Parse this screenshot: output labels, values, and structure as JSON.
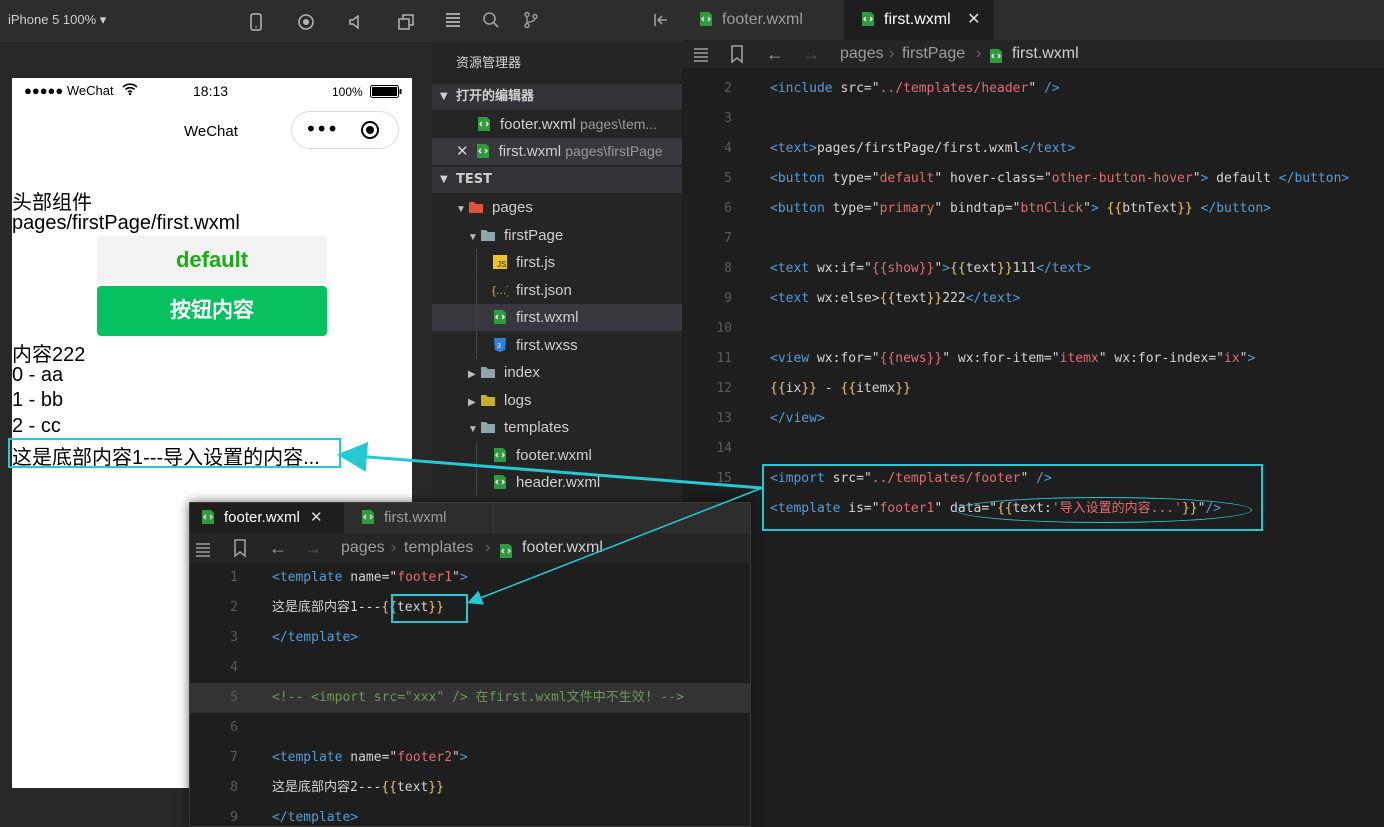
{
  "simulator": {
    "device_label": "iPhone 5 100% ▾",
    "status": {
      "carrier": "●●●●● WeChat",
      "time": "18:13",
      "battery": "100%"
    },
    "nav_title": "WeChat",
    "content": {
      "header_text": "头部组件",
      "path_text": "pages/firstPage/first.wxml",
      "default_button": "default",
      "primary_button": "按钮内容",
      "else_text": "内容222",
      "list": [
        "0 - aa",
        "1 - bb",
        "2 - cc"
      ],
      "footer_text": "这是底部内容1---导入设置的内容..."
    }
  },
  "explorer": {
    "title": "资源管理器",
    "open_editors_label": "打开的编辑器",
    "open_editors": [
      {
        "name": "footer.wxml",
        "path": "pages\\tem..."
      },
      {
        "name": "first.wxml",
        "path": "pages\\firstPage"
      }
    ],
    "project_label": "TEST",
    "tree": [
      {
        "name": "pages",
        "icon": "folder-red-icon",
        "arrow": "▼"
      },
      {
        "name": "firstPage",
        "icon": "folder-open-icon",
        "arrow": "▼"
      },
      {
        "name": "first.js",
        "icon": "js-file-icon",
        "arrow": ""
      },
      {
        "name": "first.json",
        "icon": "json-file-icon",
        "arrow": ""
      },
      {
        "name": "first.wxml",
        "icon": "wxml-file-icon",
        "arrow": ""
      },
      {
        "name": "first.wxss",
        "icon": "css-file-icon",
        "arrow": ""
      },
      {
        "name": "index",
        "icon": "folder-icon",
        "arrow": "▶"
      },
      {
        "name": "logs",
        "icon": "folder-yellow-icon",
        "arrow": "▶"
      },
      {
        "name": "templates",
        "icon": "folder-icon",
        "arrow": "▼"
      },
      {
        "name": "footer.wxml",
        "icon": "wxml-file-icon",
        "arrow": ""
      },
      {
        "name": "header.wxml",
        "icon": "wxml-file-icon",
        "arrow": ""
      }
    ]
  },
  "editor": {
    "tabs": [
      {
        "label": "footer.wxml",
        "active": false
      },
      {
        "label": "first.wxml",
        "active": true,
        "close": "✕"
      }
    ],
    "breadcrumb": [
      "pages",
      "firstPage",
      "first.wxml"
    ],
    "lines": [
      {
        "n": "2",
        "parts": [
          [
            "c-tag",
            "<include "
          ],
          [
            "c-attr",
            "src="
          ],
          [
            "c-q",
            "\""
          ],
          [
            "c-str",
            "../templates/header"
          ],
          [
            "c-q",
            "\""
          ],
          [
            "c-tag",
            " />"
          ]
        ]
      },
      {
        "n": "3",
        "parts": []
      },
      {
        "n": "4",
        "parts": [
          [
            "c-tag",
            "<text>"
          ],
          [
            "c-attr",
            "pages/firstPage/first.wxml"
          ],
          [
            "c-tag",
            "</text>"
          ]
        ]
      },
      {
        "n": "5",
        "parts": [
          [
            "c-tag",
            "<button "
          ],
          [
            "c-attr",
            "type="
          ],
          [
            "c-q",
            "\""
          ],
          [
            "c-str",
            "default"
          ],
          [
            "c-q",
            "\""
          ],
          [
            "c-attr",
            " hover-class="
          ],
          [
            "c-q",
            "\""
          ],
          [
            "c-str",
            "other-button-hover"
          ],
          [
            "c-q",
            "\""
          ],
          [
            "c-tag",
            "> "
          ],
          [
            "c-attr",
            "default "
          ],
          [
            "c-tag",
            "</button>"
          ]
        ]
      },
      {
        "n": "6",
        "parts": [
          [
            "c-tag",
            "<button "
          ],
          [
            "c-attr",
            "type="
          ],
          [
            "c-q",
            "\""
          ],
          [
            "c-str",
            "primary"
          ],
          [
            "c-q",
            "\""
          ],
          [
            "c-attr",
            " bindtap="
          ],
          [
            "c-q",
            "\""
          ],
          [
            "c-str",
            "btnClick"
          ],
          [
            "c-q",
            "\""
          ],
          [
            "c-tag",
            "> "
          ],
          [
            "c-br",
            "{{"
          ],
          [
            "c-attr",
            "btnText"
          ],
          [
            "c-br",
            "}}"
          ],
          [
            "c-tag",
            " </button>"
          ]
        ]
      },
      {
        "n": "7",
        "parts": []
      },
      {
        "n": "8",
        "parts": [
          [
            "c-tag",
            "<text "
          ],
          [
            "c-attr",
            "wx:if="
          ],
          [
            "c-q",
            "\""
          ],
          [
            "c-str",
            "{{show}}"
          ],
          [
            "c-q",
            "\""
          ],
          [
            "c-tag",
            ">"
          ],
          [
            "c-br",
            "{{"
          ],
          [
            "c-attr",
            "text"
          ],
          [
            "c-br",
            "}}"
          ],
          [
            "c-attr",
            "111"
          ],
          [
            "c-tag",
            "</text>"
          ]
        ]
      },
      {
        "n": "9",
        "parts": [
          [
            "c-tag",
            "<text "
          ],
          [
            "c-attr",
            "wx:else>"
          ],
          [
            "c-br",
            "{{"
          ],
          [
            "c-attr",
            "text"
          ],
          [
            "c-br",
            "}}"
          ],
          [
            "c-attr",
            "222"
          ],
          [
            "c-tag",
            "</text>"
          ]
        ]
      },
      {
        "n": "10",
        "parts": []
      },
      {
        "n": "11",
        "parts": [
          [
            "c-tag",
            "<view "
          ],
          [
            "c-attr",
            "wx:for="
          ],
          [
            "c-q",
            "\""
          ],
          [
            "c-str",
            "{{news}}"
          ],
          [
            "c-q",
            "\""
          ],
          [
            "c-attr",
            " wx:for-item="
          ],
          [
            "c-q",
            "\""
          ],
          [
            "c-str",
            "itemx"
          ],
          [
            "c-q",
            "\""
          ],
          [
            "c-attr",
            " wx:for-index="
          ],
          [
            "c-q",
            "\""
          ],
          [
            "c-str",
            "ix"
          ],
          [
            "c-q",
            "\""
          ],
          [
            "c-tag",
            ">"
          ]
        ]
      },
      {
        "n": "12",
        "parts": [
          [
            "c-attr",
            "  "
          ],
          [
            "c-br",
            "{{"
          ],
          [
            "c-attr",
            "ix"
          ],
          [
            "c-br",
            "}}"
          ],
          [
            "c-attr",
            " - "
          ],
          [
            "c-br",
            "{{"
          ],
          [
            "c-attr",
            "itemx"
          ],
          [
            "c-br",
            "}}"
          ]
        ]
      },
      {
        "n": "13",
        "parts": [
          [
            "c-tag",
            "</view>"
          ]
        ]
      },
      {
        "n": "14",
        "parts": []
      },
      {
        "n": "15",
        "parts": [
          [
            "c-tag",
            "<import "
          ],
          [
            "c-attr",
            "src="
          ],
          [
            "c-q",
            "\""
          ],
          [
            "c-str",
            "../templates/footer"
          ],
          [
            "c-q",
            "\""
          ],
          [
            "c-tag",
            " />"
          ]
        ]
      },
      {
        "n": "",
        "parts": [
          [
            "c-tag",
            "<template "
          ],
          [
            "c-attr",
            "is="
          ],
          [
            "c-q",
            "\""
          ],
          [
            "c-str",
            "footer1"
          ],
          [
            "c-q",
            "\""
          ],
          [
            "c-attr",
            " data="
          ],
          [
            "c-q",
            "\""
          ],
          [
            "c-br",
            "{{"
          ],
          [
            "c-attr",
            "text:"
          ],
          [
            "c-str",
            "'导入设置的内容...'"
          ],
          [
            "c-br",
            "}}"
          ],
          [
            "c-q",
            "\""
          ],
          [
            "c-tag",
            "/>"
          ]
        ]
      }
    ]
  },
  "popup": {
    "tabs": [
      {
        "label": "footer.wxml",
        "active": true,
        "close": "✕"
      },
      {
        "label": "first.wxml",
        "active": false
      }
    ],
    "breadcrumb": [
      "pages",
      "templates",
      "footer.wxml"
    ],
    "lines": [
      {
        "n": "1",
        "parts": [
          [
            "c-tag",
            "<template "
          ],
          [
            "c-attr",
            "name="
          ],
          [
            "c-q",
            "\""
          ],
          [
            "c-str",
            "footer1"
          ],
          [
            "c-q",
            "\""
          ],
          [
            "c-tag",
            ">"
          ]
        ]
      },
      {
        "n": "2",
        "parts": [
          [
            "c-attr",
            "这是底部内容1---"
          ],
          [
            "c-br",
            "{{"
          ],
          [
            "c-attr",
            "text"
          ],
          [
            "c-br",
            "}}"
          ]
        ]
      },
      {
        "n": "3",
        "parts": [
          [
            "c-tag",
            "</template>"
          ]
        ]
      },
      {
        "n": "4",
        "parts": []
      },
      {
        "n": "5",
        "parts": [
          [
            "c-cmt",
            "<!-- <import src=\"xxx\" />   在first.wxml文件中不生效!  -->"
          ]
        ],
        "highlight": true
      },
      {
        "n": "6",
        "parts": []
      },
      {
        "n": "7",
        "parts": [
          [
            "c-tag",
            "<template "
          ],
          [
            "c-attr",
            "name="
          ],
          [
            "c-q",
            "\""
          ],
          [
            "c-str",
            "footer2"
          ],
          [
            "c-q",
            "\""
          ],
          [
            "c-tag",
            ">"
          ]
        ]
      },
      {
        "n": "8",
        "parts": [
          [
            "c-attr",
            "这是底部内容2---"
          ],
          [
            "c-br",
            "{{"
          ],
          [
            "c-attr",
            "text"
          ],
          [
            "c-br",
            "}}"
          ]
        ]
      },
      {
        "n": "9",
        "parts": [
          [
            "c-tag",
            "</template>"
          ]
        ]
      }
    ]
  },
  "colors": {
    "accent": "#26c9d1",
    "wechat_green": "#07c160",
    "default_green": "#1aad19"
  }
}
